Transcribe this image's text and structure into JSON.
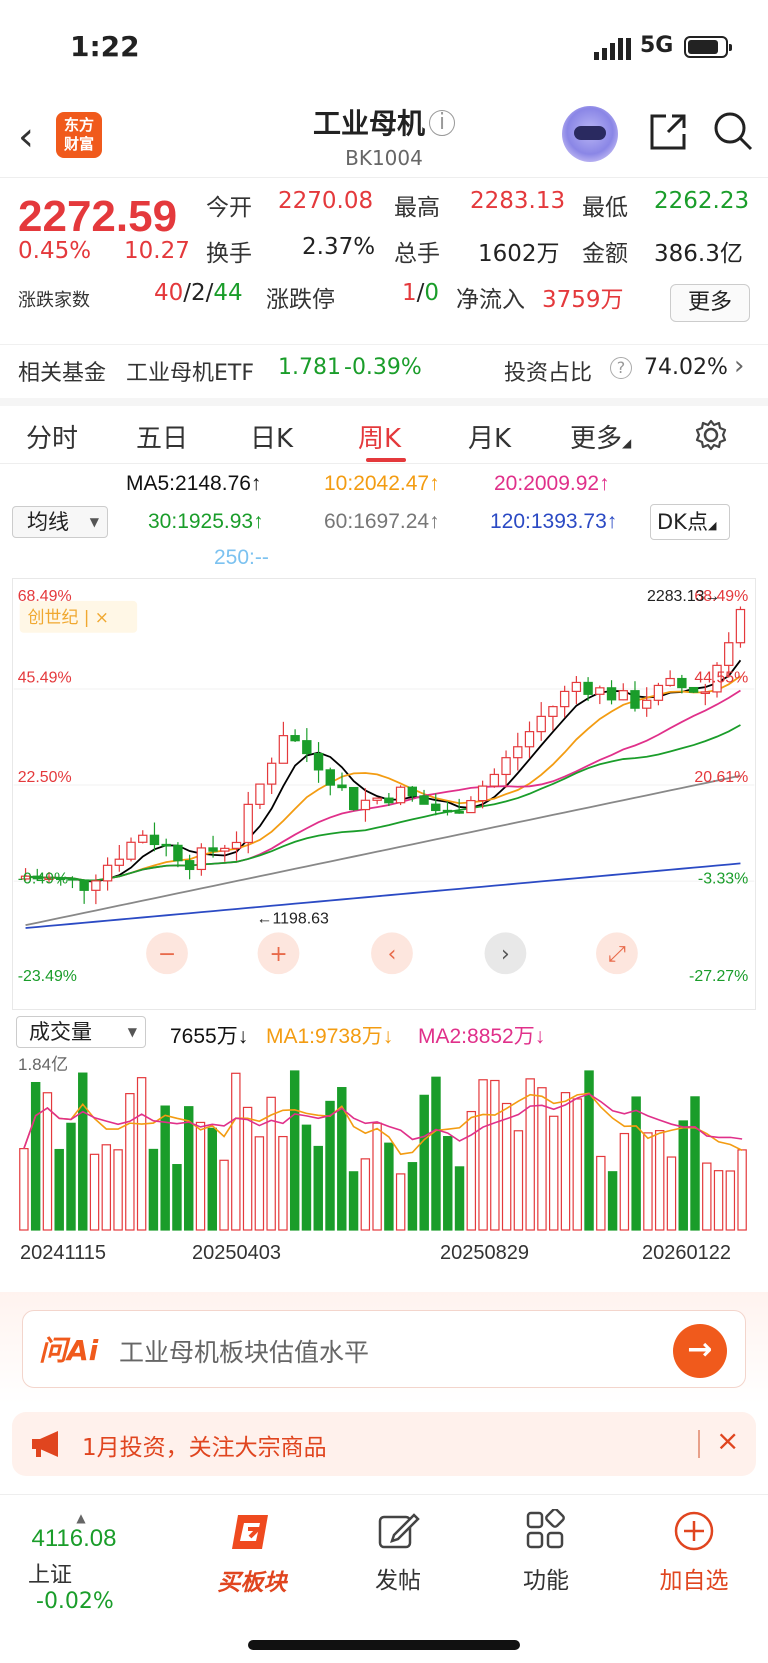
{
  "status": {
    "time": "1:22",
    "network": "5G",
    "battery_level": 0.75
  },
  "header": {
    "back_icon": "chevron-left-icon",
    "logo_text_1": "东方",
    "logo_text_2": "财富",
    "title": "工业母机",
    "info_icon": "info-icon",
    "code": "BK1004"
  },
  "quote": {
    "price": "2272.59",
    "change_pct": "0.45%",
    "change": "10.27",
    "open_label": "今开",
    "open": "2270.08",
    "high_label": "最高",
    "high": "2283.13",
    "low_label": "最低",
    "low": "2262.23",
    "turnover_label": "换手",
    "turnover": "2.37%",
    "volume_label": "总手",
    "volume": "1602万",
    "amount_label": "金额",
    "amount": "386.3亿",
    "breadth_label": "涨跌家数",
    "breadth_up": "40",
    "breadth_flat": "2",
    "breadth_down": "44",
    "sep": "/",
    "limit_label": "涨跌停",
    "limit_up": "1",
    "limit_down": "0",
    "inflow_label": "净流入",
    "inflow": "3759万",
    "more": "更多"
  },
  "fund": {
    "label": "相关基金",
    "name": "工业母机ETF",
    "price": "1.781",
    "change": "-0.39%",
    "ratio_label": "投资占比",
    "ratio": "74.02%"
  },
  "tabs": [
    "分时",
    "五日",
    "日K",
    "周K",
    "月K",
    "更多"
  ],
  "active_tab": "周K",
  "ma": {
    "selector": "均线",
    "ma5": "MA5:2148.76↑",
    "ma10": "10:2042.47↑",
    "ma20": "20:2009.92↑",
    "ma30": "30:1925.93↑",
    "ma60": "60:1697.24↑",
    "ma120": "120:1393.73↑",
    "ma250": "250:--",
    "dk": "DK点"
  },
  "chart_overlay": {
    "left_labels": [
      "68.49%",
      "45.49%",
      "22.50%",
      "-0.49%",
      "-23.49%"
    ],
    "right_labels": [
      "68.49%",
      "44.55%",
      "20.61%",
      "-3.33%",
      "-27.27%"
    ],
    "high_marker": "2283.13",
    "low_marker": "1198.63",
    "tag": "创世纪",
    "tag_close": "×"
  },
  "volume": {
    "selector": "成交量",
    "value": "7655万↓",
    "ma1": "MA1:9738万↓",
    "ma2": "MA2:8852万↓",
    "max_label": "1.84亿"
  },
  "dates": [
    "20241115",
    "20250403",
    "20250829",
    "20260122"
  ],
  "ai": {
    "logo": "问Ai",
    "question": "工业母机板块估值水平",
    "go": "→"
  },
  "notice": {
    "text": "1月投资，关注大宗商品",
    "close": "×"
  },
  "bottom": {
    "index_value": "4116.08",
    "index_name": "上证",
    "index_change": "-0.02%",
    "buy_label": "买板块",
    "post_label": "发帖",
    "func_label": "功能",
    "add_label": "加自选"
  },
  "chart_data": {
    "type": "candlestick",
    "period": "weekly",
    "y_range": [
      1000,
      2330
    ],
    "high": 2283.13,
    "low": 1198.63,
    "ma_values": {
      "MA5": 2148.76,
      "MA10": 2042.47,
      "MA20": 2009.92,
      "MA30": 1925.93,
      "MA60": 1697.24,
      "MA120": 1393.73
    },
    "colors": {
      "up": "#e4393c",
      "down": "#1a9d2a",
      "ma5": "#000000",
      "ma10": "#f39c12",
      "ma20": "#e0308a",
      "ma30": "#1a9d2a",
      "ma60": "#888888",
      "ma120": "#2b4ac4"
    }
  }
}
